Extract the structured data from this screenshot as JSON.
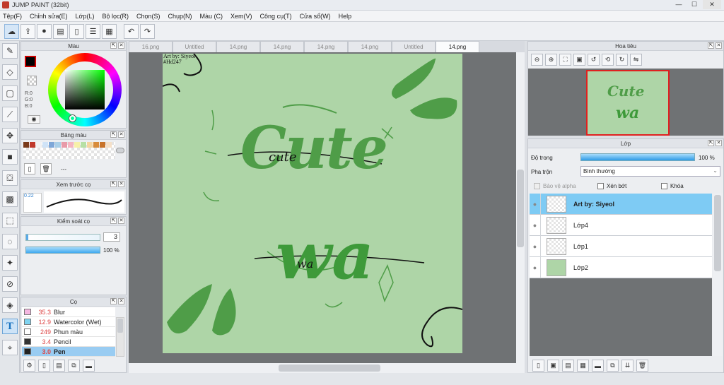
{
  "window": {
    "title": "JUMP PAINT (32bit)",
    "minimize": "—",
    "maximize": "☐",
    "close": "✕"
  },
  "menu": [
    "Tệp(F)",
    "Chỉnh sửa(E)",
    "Lớp(L)",
    "Bộ lọc(R)",
    "Chọn(S)",
    "Chụp(N)",
    "Màu (C)",
    "Xem(V)",
    "Công cụ(T)",
    "Cửa sổ(W)",
    "Help"
  ],
  "toolbar": {
    "icons": [
      "cloud-icon",
      "export-icon",
      "speech-bubble-icon",
      "comment-icon",
      "page-icon",
      "page-list-icon",
      "grid-icon",
      "undo-icon",
      "redo-icon"
    ]
  },
  "tabs": [
    "16.png",
    "Untitled",
    "14.png",
    "14.png",
    "14.png",
    "14.png",
    "Untitled",
    "14.png"
  ],
  "active_tab_index": 7,
  "color_panel": {
    "title": "Màu",
    "r_label": "R:0",
    "g_label": "G:0",
    "b_label": "B:0",
    "fg_color": "#000000",
    "bg_color": "#ffffff"
  },
  "palette_panel": {
    "title": "Bảng màu",
    "swatches": [
      "#7a3b1b",
      "#c0392b",
      "#f2f2f2",
      "#cfe3f7",
      "#7ea7d8",
      "#a9cfe8",
      "#e89aa8",
      "#f4b6c2",
      "#f7f1a8",
      "#b7e0a5",
      "#f5d5a0",
      "#d88c3b",
      "#c8732a",
      "#f5e0c8"
    ],
    "extra_label": "---"
  },
  "preview_panel": {
    "title": "Xem trước cọ",
    "size_label": "0.22"
  },
  "control_panel": {
    "title": "Kiểm soát cọ",
    "size_value": "3",
    "opacity_label": "100 %",
    "opacity": 1.0
  },
  "brush_panel": {
    "title": "Cọ",
    "items": [
      {
        "size": "35.3",
        "name": "Blur",
        "color": "#f4b6e0"
      },
      {
        "size": "12.9",
        "name": "Watercolor (Wet)",
        "color": "#7fd3f0"
      },
      {
        "size": "249",
        "name": "Phun màu",
        "color": "#ffffff"
      },
      {
        "size": "3.4",
        "name": "Pencil",
        "color": "#333333"
      },
      {
        "size": "3.0",
        "name": "Pen",
        "color": "#222222"
      }
    ],
    "selected_index": 4
  },
  "artwork": {
    "credit_line1": "Art by: Siyeol",
    "credit_line2": "#Hd247",
    "word1": "Cute",
    "word1_script": "cute",
    "word2": "wa",
    "word2_script": "wa",
    "background": "#aed5a7",
    "accent": "#4f9d48"
  },
  "navigator_panel": {
    "title": "Hoa tiêu"
  },
  "layer_panel": {
    "title": "Lớp",
    "opacity_label": "Độ trong",
    "opacity_value": "100 %",
    "opacity": 1.0,
    "blend_label": "Pha trộn",
    "blend_value": "Bình thường",
    "protect_alpha": "Bảo vệ alpha",
    "clip": "Xén bớt",
    "lock": "Khóa",
    "layers": [
      {
        "name": "Art by: Siyeol",
        "thumb": "text"
      },
      {
        "name": "Lớp4",
        "thumb": "empty"
      },
      {
        "name": "Lớp1",
        "thumb": "art"
      },
      {
        "name": "Lớp2",
        "thumb": "fill"
      }
    ],
    "selected_index": 0
  },
  "colors": {
    "accent": "#2a7fd0",
    "selection": "#7ecbf4"
  }
}
